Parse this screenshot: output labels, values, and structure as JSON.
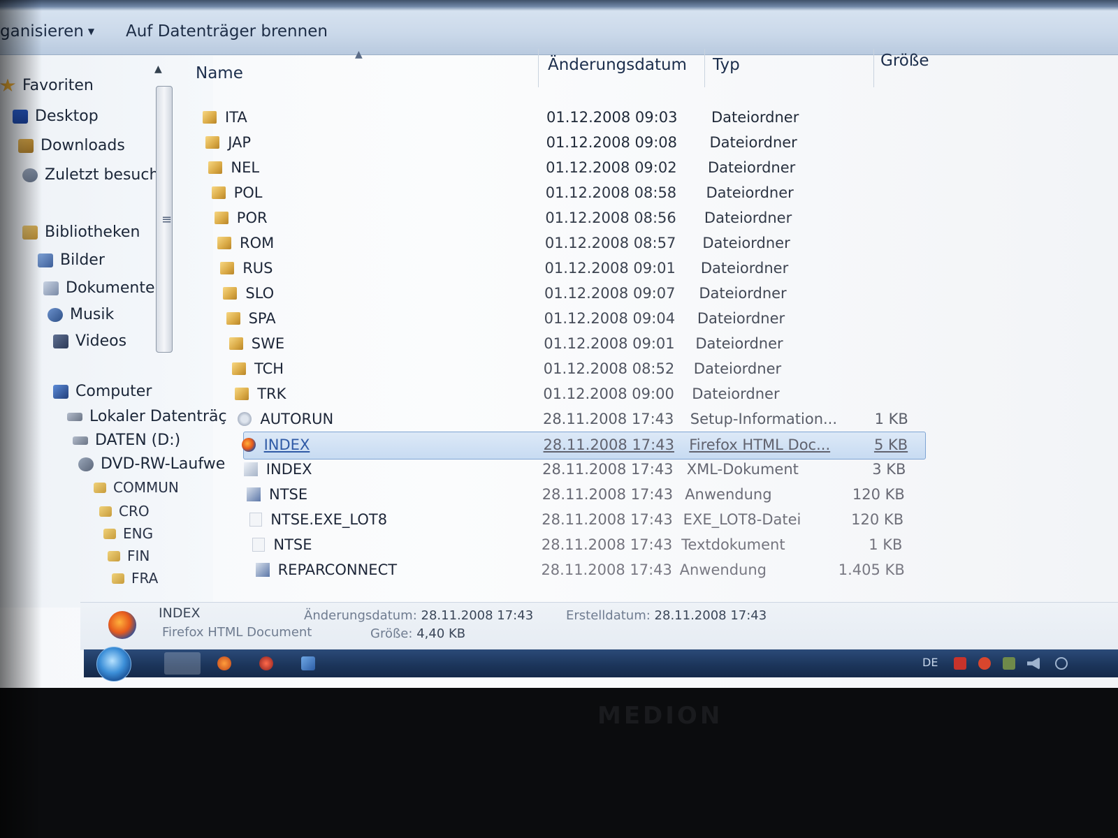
{
  "toolbar": {
    "organize_label": "ganisieren",
    "burn_label": "Auf Datenträger brennen"
  },
  "nav": {
    "favorites": [
      {
        "label": "Favoriten",
        "icon": "star-icon",
        "kind": "header"
      },
      {
        "label": "Desktop",
        "icon": "desktop-icon"
      },
      {
        "label": "Downloads",
        "icon": "downloads-icon"
      },
      {
        "label": "Zuletzt besucht",
        "icon": "recent-places-icon"
      }
    ],
    "libraries": [
      {
        "label": "Bibliotheken",
        "icon": "libraries-icon",
        "kind": "header"
      },
      {
        "label": "Bilder",
        "icon": "pictures-icon"
      },
      {
        "label": "Dokumente",
        "icon": "documents-icon"
      },
      {
        "label": "Musik",
        "icon": "music-icon"
      },
      {
        "label": "Videos",
        "icon": "videos-icon"
      }
    ],
    "computer": [
      {
        "label": "Computer",
        "icon": "computer-icon",
        "kind": "header"
      },
      {
        "label": "Lokaler Datenträç",
        "icon": "drive-icon"
      },
      {
        "label": "DATEN (D:)",
        "icon": "drive-icon"
      },
      {
        "label": "DVD-RW-Laufwe",
        "icon": "dvd-drive-icon"
      },
      {
        "label": "COMMUN",
        "icon": "folder-icon"
      },
      {
        "label": "CRO",
        "icon": "folder-icon"
      },
      {
        "label": "ENG",
        "icon": "folder-icon"
      },
      {
        "label": "FIN",
        "icon": "folder-icon"
      },
      {
        "label": "FRA",
        "icon": "folder-icon"
      }
    ]
  },
  "columns": {
    "name": "Name",
    "date": "Änderungsdatum",
    "type": "Typ",
    "size": "Größe"
  },
  "files": [
    {
      "name": "ITA",
      "date": "01.12.2008 09:03",
      "type": "Dateiordner",
      "size": "",
      "icon": "folder-icon"
    },
    {
      "name": "JAP",
      "date": "01.12.2008 09:08",
      "type": "Dateiordner",
      "size": "",
      "icon": "folder-icon"
    },
    {
      "name": "NEL",
      "date": "01.12.2008 09:02",
      "type": "Dateiordner",
      "size": "",
      "icon": "folder-icon"
    },
    {
      "name": "POL",
      "date": "01.12.2008 08:58",
      "type": "Dateiordner",
      "size": "",
      "icon": "folder-icon"
    },
    {
      "name": "POR",
      "date": "01.12.2008 08:56",
      "type": "Dateiordner",
      "size": "",
      "icon": "folder-icon"
    },
    {
      "name": "ROM",
      "date": "01.12.2008 08:57",
      "type": "Dateiordner",
      "size": "",
      "icon": "folder-icon"
    },
    {
      "name": "RUS",
      "date": "01.12.2008 09:01",
      "type": "Dateiordner",
      "size": "",
      "icon": "folder-icon"
    },
    {
      "name": "SLO",
      "date": "01.12.2008 09:07",
      "type": "Dateiordner",
      "size": "",
      "icon": "folder-icon"
    },
    {
      "name": "SPA",
      "date": "01.12.2008 09:04",
      "type": "Dateiordner",
      "size": "",
      "icon": "folder-icon"
    },
    {
      "name": "SWE",
      "date": "01.12.2008 09:01",
      "type": "Dateiordner",
      "size": "",
      "icon": "folder-icon"
    },
    {
      "name": "TCH",
      "date": "01.12.2008 08:52",
      "type": "Dateiordner",
      "size": "",
      "icon": "folder-icon"
    },
    {
      "name": "TRK",
      "date": "01.12.2008 09:00",
      "type": "Dateiordner",
      "size": "",
      "icon": "folder-icon"
    },
    {
      "name": "AUTORUN",
      "date": "28.11.2008 17:43",
      "type": "Setup-Information...",
      "size": "1 KB",
      "icon": "setup-info-icon"
    },
    {
      "name": "INDEX",
      "date": "28.11.2008 17:43",
      "type": "Firefox HTML Doc...",
      "size": "5 KB",
      "icon": "firefox-icon",
      "selected": true
    },
    {
      "name": "INDEX",
      "date": "28.11.2008 17:43",
      "type": "XML-Dokument",
      "size": "3 KB",
      "icon": "xml-document-icon"
    },
    {
      "name": "NTSE",
      "date": "28.11.2008 17:43",
      "type": "Anwendung",
      "size": "120 KB",
      "icon": "application-icon"
    },
    {
      "name": "NTSE.EXE_LOT8",
      "date": "28.11.2008 17:43",
      "type": "EXE_LOT8-Datei",
      "size": "120 KB",
      "icon": "blank-file-icon"
    },
    {
      "name": "NTSE",
      "date": "28.11.2008 17:43",
      "type": "Textdokument",
      "size": "1 KB",
      "icon": "text-document-icon"
    },
    {
      "name": "REPARCONNECT",
      "date": "28.11.2008 17:43",
      "type": "Anwendung",
      "size": "1.405 KB",
      "icon": "application-icon"
    }
  ],
  "details": {
    "name": "INDEX",
    "type": "Firefox HTML Document",
    "modified_label": "Änderungsdatum:",
    "modified_value": "28.11.2008 17:43",
    "created_label": "Erstelldatum:",
    "created_value": "28.11.2008 17:43",
    "size_label": "Größe:",
    "size_value": "4,40 KB"
  },
  "taskbar": {
    "language": "DE"
  },
  "colors": {
    "selection_bg": "#c7dbf2",
    "selection_border": "#7ea4d3",
    "link_blue": "#2f5aa6",
    "taskbar": "#1b3459"
  }
}
